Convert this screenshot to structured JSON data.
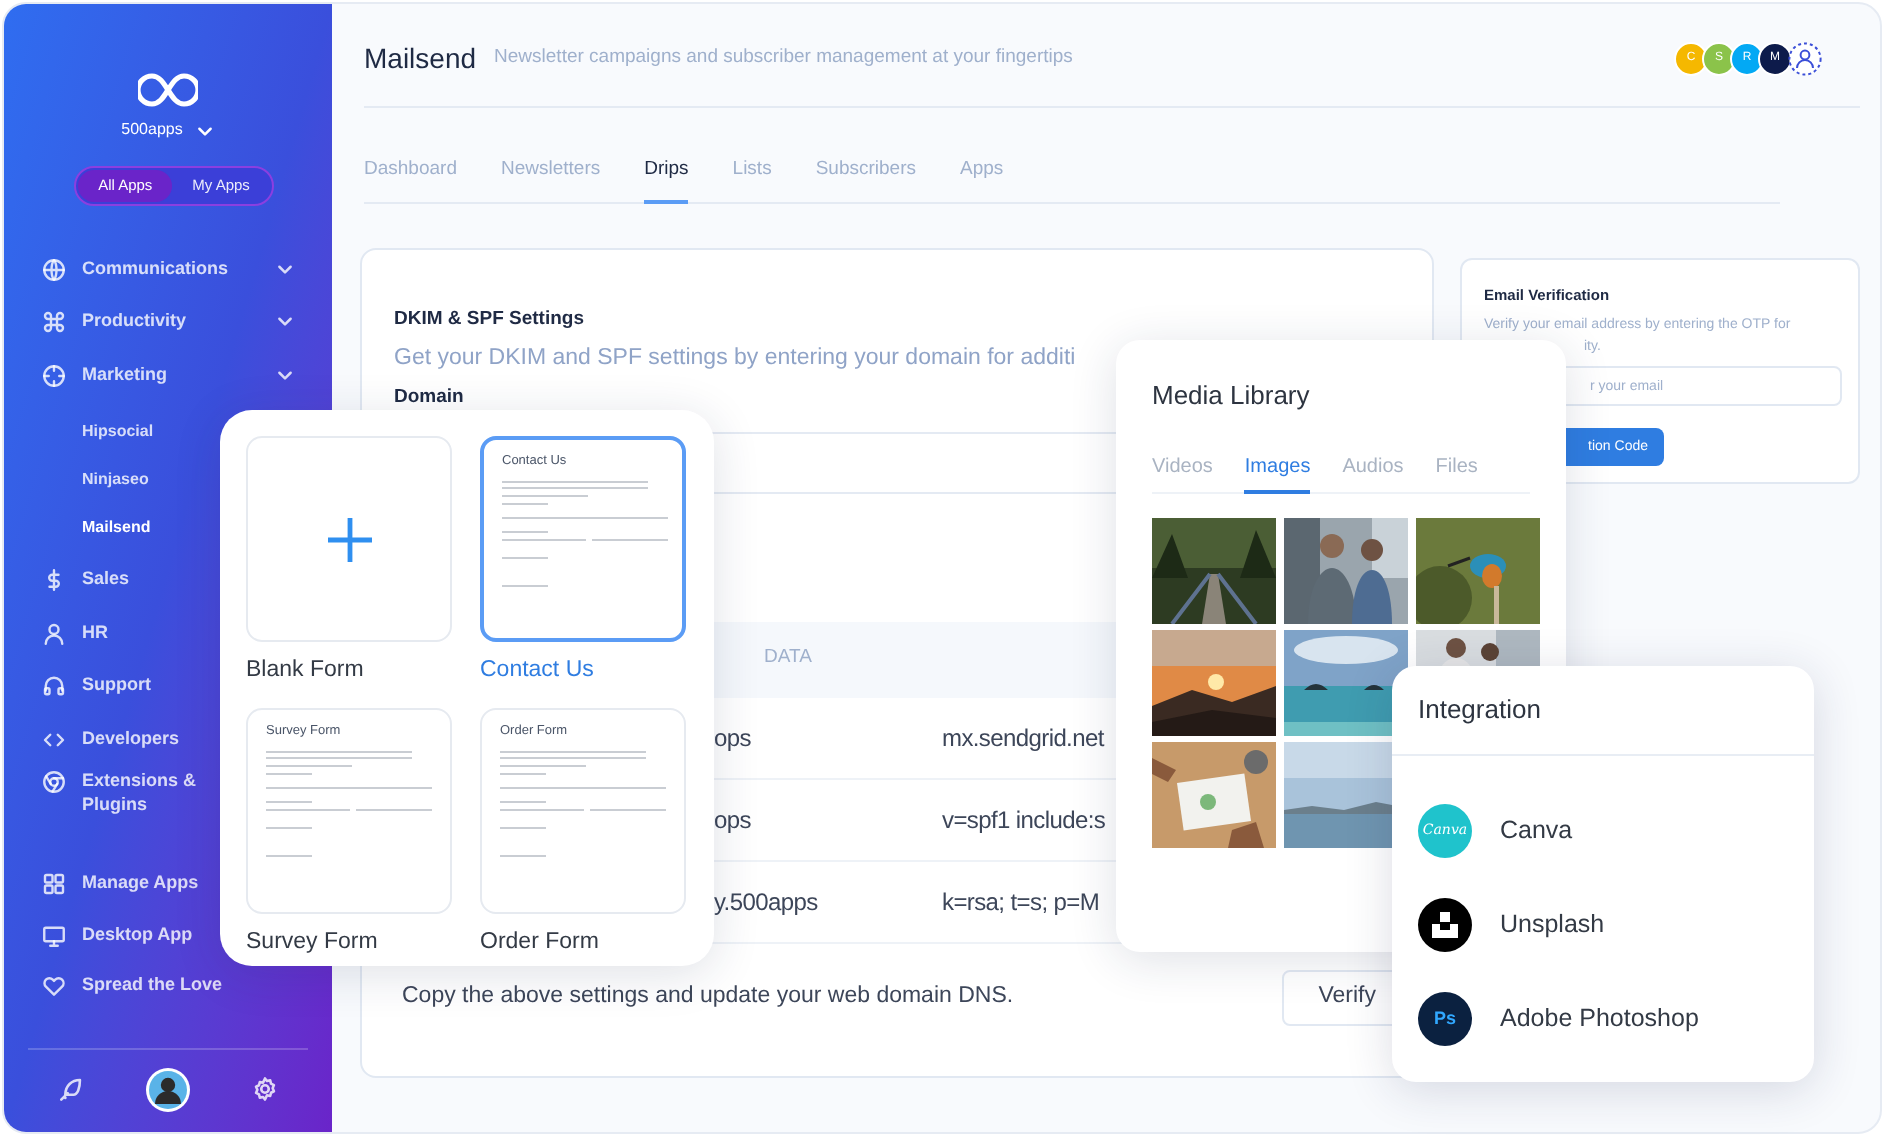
{
  "sidebar": {
    "brand": "500apps",
    "switch": [
      {
        "label": "All Apps",
        "selected": true
      },
      {
        "label": "My Apps",
        "selected": false
      }
    ],
    "items": [
      {
        "label": "Communications",
        "expandable": true
      },
      {
        "label": "Productivity",
        "expandable": true
      },
      {
        "label": "Marketing",
        "expandable": true,
        "children": [
          {
            "label": "Hipsocial",
            "selected": false
          },
          {
            "label": "Ninjaseo",
            "selected": false
          },
          {
            "label": "Mailsend",
            "selected": true
          }
        ]
      },
      {
        "label": "Sales",
        "expandable": false
      },
      {
        "label": "HR",
        "expandable": false
      },
      {
        "label": "Support",
        "expandable": false
      },
      {
        "label": "Developers",
        "expandable": false
      },
      {
        "label": "Extensions & Plugins",
        "expandable": false
      }
    ],
    "footer_items": [
      {
        "label": "Manage Apps"
      },
      {
        "label": "Desktop App"
      },
      {
        "label": "Spread the Love"
      }
    ]
  },
  "header": {
    "title": "Mailsend",
    "subtitle": "Newsletter campaigns and subscriber management at your fingertips",
    "avatars": [
      {
        "initial": "C",
        "color": "#f5b800"
      },
      {
        "initial": "S",
        "color": "#8bc34a"
      },
      {
        "initial": "R",
        "color": "#03a9f4"
      },
      {
        "initial": "M",
        "color": "#0d1b4b"
      }
    ]
  },
  "tabs": [
    {
      "label": "Dashboard",
      "selected": false
    },
    {
      "label": "Newsletters",
      "selected": false
    },
    {
      "label": "Drips",
      "selected": true
    },
    {
      "label": "Lists",
      "selected": false
    },
    {
      "label": "Subscribers",
      "selected": false
    },
    {
      "label": "Apps",
      "selected": false
    }
  ],
  "dkim": {
    "title": "DKIM & SPF Settings",
    "description": "Get your DKIM and SPF settings by entering your domain for additi",
    "domain_label": "Domain",
    "table": {
      "columns": [
        "DATA"
      ],
      "rows": [
        [
          "ops",
          "mx.sendgrid.net"
        ],
        [
          "ops",
          "v=spf1 include:s"
        ],
        [
          "y.500apps",
          "k=rsa; t=s; p=M"
        ]
      ]
    },
    "note": "Copy the above settings and update your web domain DNS.",
    "button": "Verify"
  },
  "email_verification": {
    "title": "Email Verification",
    "description": "Verify your email address by entering the OTP for",
    "description_end": "ity.",
    "placeholder": "r your email",
    "button": "tion Code"
  },
  "form_previews": [
    {
      "kind": "blank"
    },
    {
      "kind": "template",
      "title": "Contact Us"
    },
    {
      "kind": "template",
      "title": "Survey Form"
    },
    {
      "kind": "template",
      "title": "Order Form"
    }
  ],
  "forms": [
    {
      "label": "Blank Form",
      "selected": false
    },
    {
      "label": "Contact Us",
      "selected": true
    },
    {
      "label": "Survey Form",
      "selected": false
    },
    {
      "label": "Order Form",
      "selected": false
    }
  ],
  "media_library": {
    "title": "Media Library",
    "tabs": [
      {
        "label": "Videos",
        "selected": false
      },
      {
        "label": "Images",
        "selected": true
      },
      {
        "label": "Audios",
        "selected": false
      },
      {
        "label": "Files",
        "selected": false
      }
    ]
  },
  "integration": {
    "title": "Integration",
    "items": [
      {
        "label": "Canva",
        "logo_text": "Canva"
      },
      {
        "label": "Unsplash"
      },
      {
        "label": "Adobe Photoshop",
        "logo_text": "Ps"
      }
    ]
  }
}
